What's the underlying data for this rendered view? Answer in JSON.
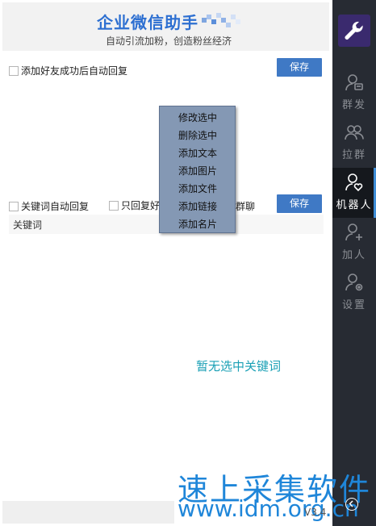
{
  "header": {
    "title": "企业微信助手",
    "subtitle": "自动引流加粉，创造粉丝经济"
  },
  "friend_reply": {
    "label": "添加好友成功后自动回复",
    "save": "保存"
  },
  "keyword_reply": {
    "auto_label": "关键词自动回复",
    "only_label": "只回复好",
    "group_label": "群聊",
    "save": "保存",
    "column_header": "关键词",
    "empty_text": "暂无选中关键词"
  },
  "context_menu": {
    "items": [
      "修改选中",
      "删除选中",
      "添加文本",
      "添加图片",
      "添加文件",
      "添加链接",
      "添加名片"
    ]
  },
  "sidebar": {
    "items": [
      {
        "label": "群发",
        "icon": "broadcast-user-icon"
      },
      {
        "label": "拉群",
        "icon": "group-icon"
      },
      {
        "label": "机器人",
        "icon": "robot-heart-user-icon",
        "active": true
      },
      {
        "label": "加人",
        "icon": "add-user-icon"
      },
      {
        "label": "设置",
        "icon": "user-settings-icon"
      }
    ]
  },
  "watermark": {
    "line1": "速上采集软件",
    "line2": "www.idm.org.cn"
  },
  "version": "V3.4",
  "colors": {
    "accent": "#3f79c5",
    "sidebar": "#272b33",
    "menu": "#8498b4",
    "empty_text": "#1aa0b5"
  }
}
